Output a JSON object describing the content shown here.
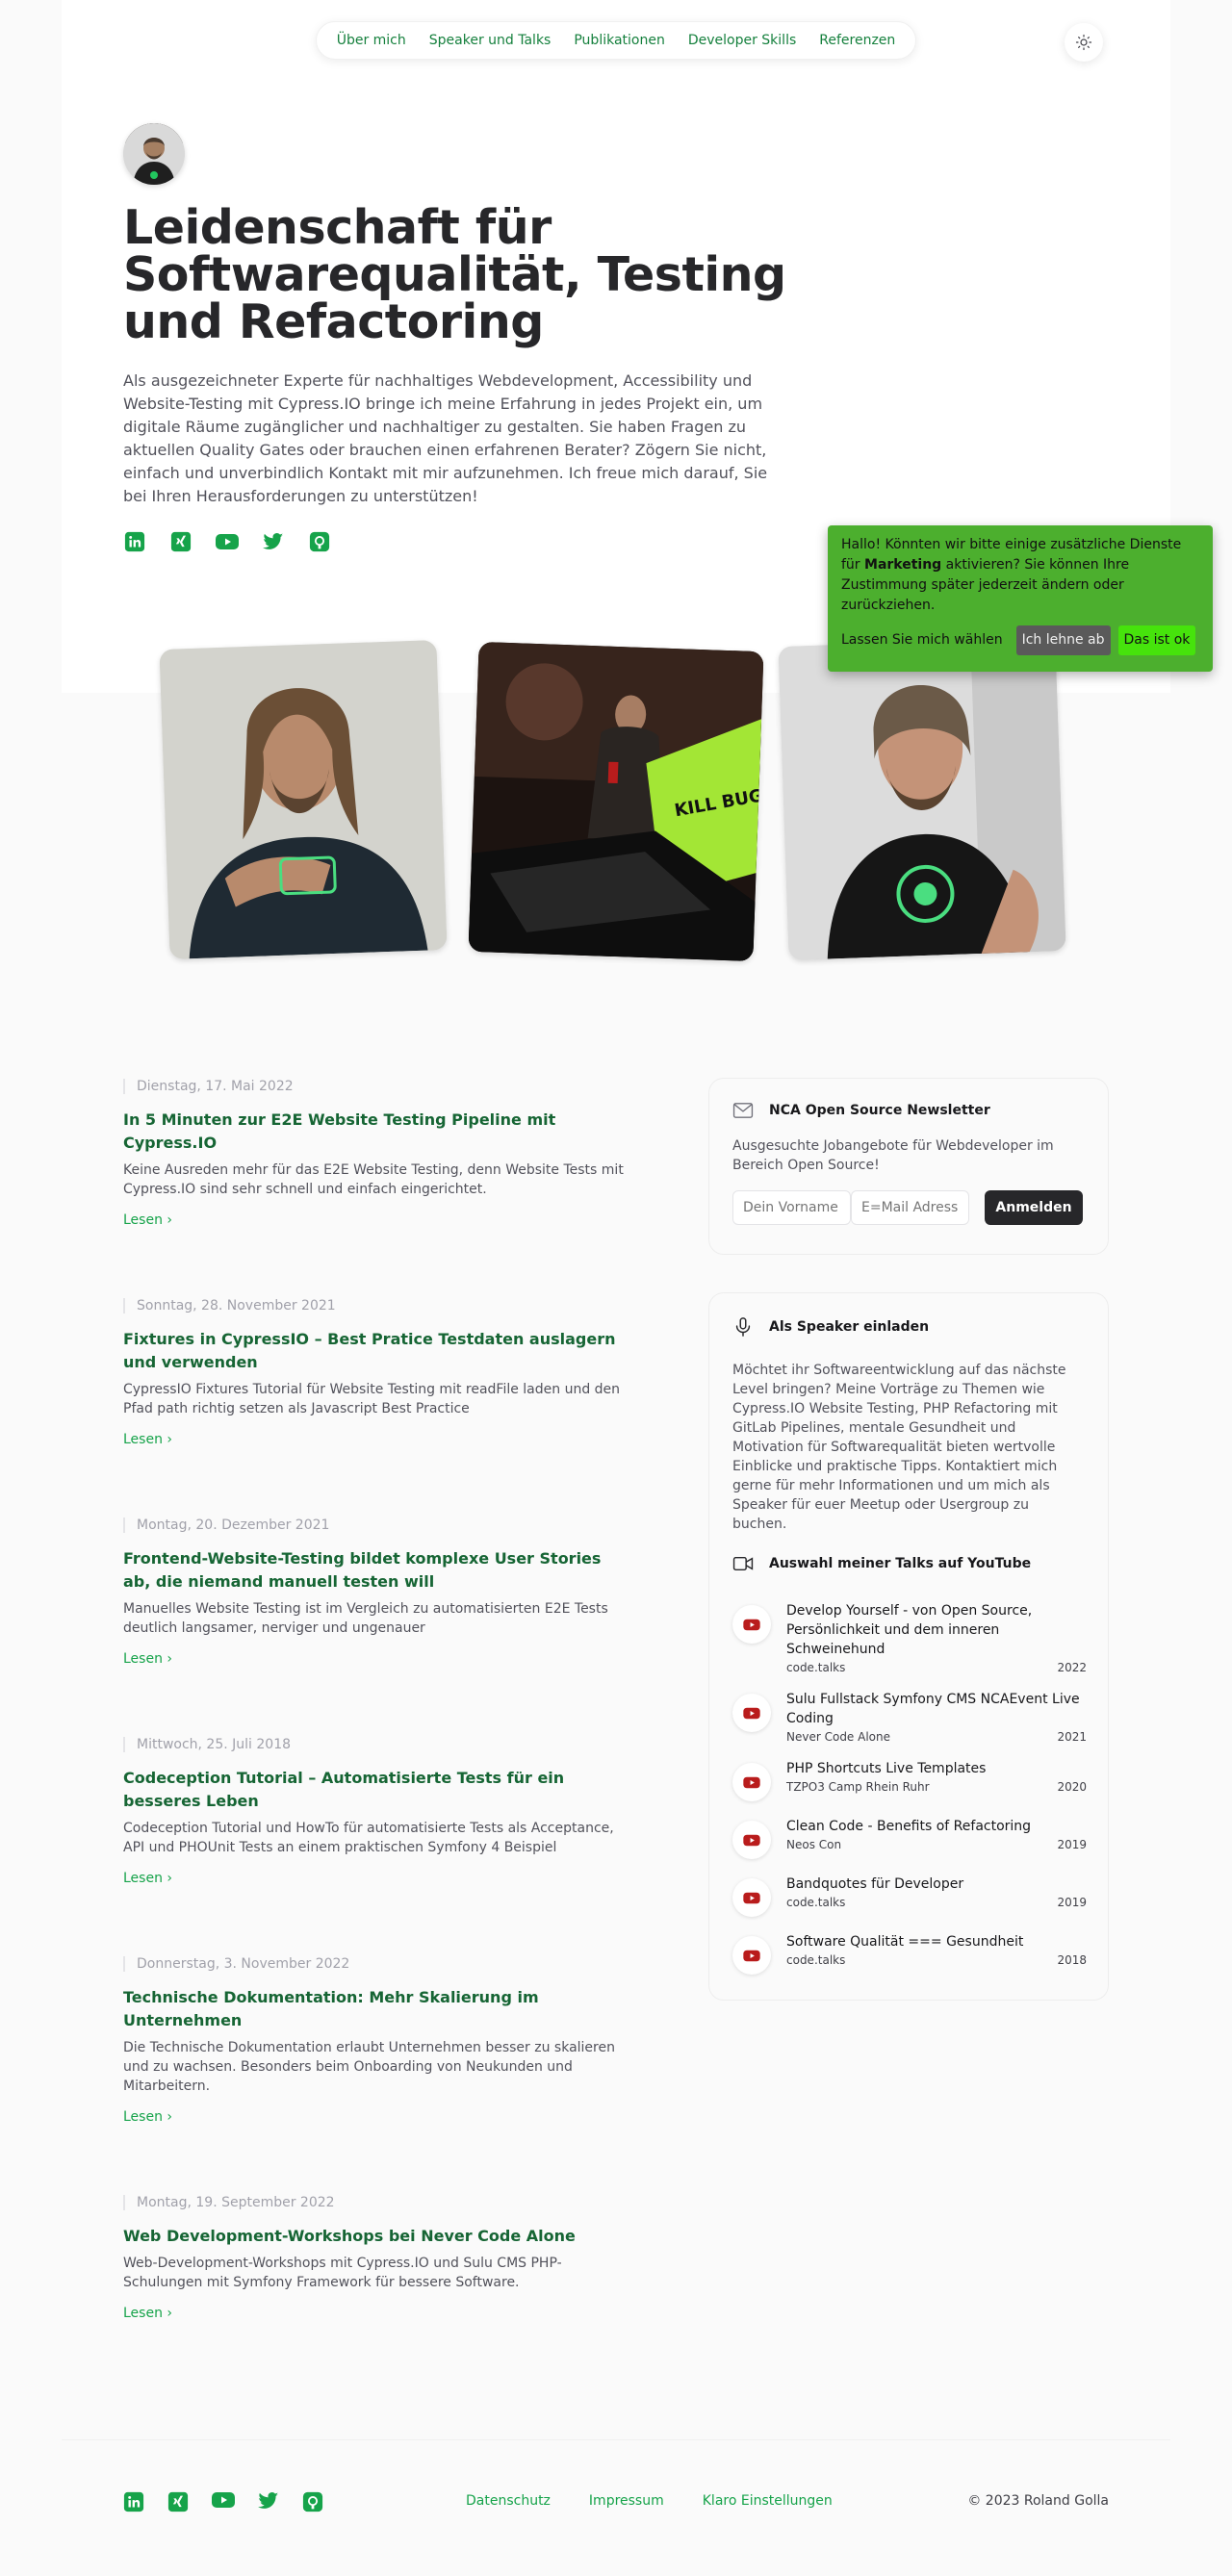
{
  "nav": {
    "items": [
      "Über mich",
      "Speaker und Talks",
      "Publikationen",
      "Developer Skills",
      "Referenzen"
    ]
  },
  "hero": {
    "title": "Leidenschaft für Softwarequalität, Testing und Refactoring",
    "text": "Als ausgezeichneter Experte für nachhaltiges Webdevelopment, Accessibility und Website-Testing mit Cypress.IO bringe ich meine Erfahrung in jedes Projekt ein, um digitale Räume zugänglicher und nachhaltiger zu gestalten. Sie haben Fragen zu aktuellen Quality Gates oder brauchen einen erfahrenen Berater? Zögern Sie nicht, einfach und unverbindlich Kontakt mit mir aufzunehmen. Ich freue mich darauf, Sie bei Ihren Herausforderungen zu unterstützen!"
  },
  "social": [
    "linkedin-icon",
    "xing-icon",
    "youtube-icon",
    "twitter-icon",
    "github-icon"
  ],
  "photos": {
    "p2_sign": "KILL BUGS"
  },
  "consent": {
    "text_before": "Hallo! Könnten wir bitte einige zusätzliche Dienste für ",
    "text_bold": "Marketing",
    "text_after": " aktivieren? Sie können Ihre Zustimmung später jederzeit ändern oder zurückziehen.",
    "learn": "Lassen Sie mich wählen",
    "decline": "Ich lehne ab",
    "accept": "Das ist ok"
  },
  "articles": [
    {
      "date": "Dienstag, 17. Mai 2022",
      "title": "In 5 Minuten zur E2E Website Testing Pipeline mit Cypress.IO",
      "desc": "Keine Ausreden mehr für das E2E Website Testing, denn Website Tests mit Cypress.IO sind sehr schnell und einfach eingerichtet.",
      "read": "Lesen"
    },
    {
      "date": "Sonntag, 28. November 2021",
      "title": "Fixtures in CypressIO – Best Pratice Testdaten auslagern und verwenden",
      "desc": "CypressIO Fixtures Tutorial für Website Testing mit readFile laden und den Pfad path richtig setzen als Javascript Best Practice",
      "read": "Lesen"
    },
    {
      "date": "Montag, 20. Dezember 2021",
      "title": "Frontend-Website-Testing bildet komplexe User Stories ab, die niemand manuell testen will",
      "desc": "Manuelles Website Testing ist im Vergleich zu automatisierten E2E Tests deutlich langsamer, nerviger und ungenauer",
      "read": "Lesen"
    },
    {
      "date": "Mittwoch, 25. Juli 2018",
      "title": "Codeception Tutorial – Automatisierte Tests für ein besseres Leben",
      "desc": "Codeception Tutorial und HowTo für automatisierte Tests als Acceptance, API und PHOUnit Tests an einem praktischen Symfony 4 Beispiel",
      "read": "Lesen"
    },
    {
      "date": "Donnerstag, 3. November 2022",
      "title": "Technische Dokumentation: Mehr Skalierung im Unternehmen",
      "desc": "Die Technische Dokumentation erlaubt Unternehmen besser zu skalieren und zu wachsen. Besonders beim Onboarding von Neukunden und Mitarbeitern.",
      "read": "Lesen"
    },
    {
      "date": "Montag, 19. September 2022",
      "title": "Web Development-Workshops bei Never Code Alone",
      "desc": "Web-Development-Workshops mit Cypress.IO und Sulu CMS PHP-Schulungen mit Symfony Framework für bessere Software.",
      "read": "Lesen"
    }
  ],
  "newsletter": {
    "title": "NCA Open Source Newsletter",
    "text": "Ausgesuchte Jobangebote für Webdeveloper im Bereich Open Source!",
    "first_name_placeholder": "Dein Vorname",
    "email_placeholder": "E=Mail Adresse",
    "submit": "Anmelden"
  },
  "speaker": {
    "title": "Als Speaker einladen",
    "text": "Möchtet ihr Softwareentwicklung auf das nächste Level bringen? Meine Vorträge zu Themen wie Cypress.IO Website Testing, PHP Refactoring mit GitLab Pipelines, mentale Gesundheit und Motivation für Softwarequalität bieten wertvolle Einblicke und praktische Tipps. Kontaktiert mich gerne für mehr Informationen und um mich als Speaker für euer Meetup oder Usergroup zu buchen.",
    "talks_title": "Auswahl meiner Talks auf YouTube",
    "talks": [
      {
        "title": "Develop Yourself - von Open Source, Persönlichkeit und dem inneren Schweinehund",
        "event": "code.talks",
        "year": "2022"
      },
      {
        "title": "Sulu Fullstack Symfony CMS NCAEvent Live Coding",
        "event": "Never Code Alone",
        "year": "2021"
      },
      {
        "title": "PHP Shortcuts Live Templates",
        "event": "TZPO3 Camp Rhein Ruhr",
        "year": "2020"
      },
      {
        "title": "Clean Code - Benefits of Refactoring",
        "event": "Neos Con",
        "year": "2019"
      },
      {
        "title": "Bandquotes für Developer",
        "event": "code.talks",
        "year": "2019"
      },
      {
        "title": "Software Qualität === Gesundheit",
        "event": "code.talks",
        "year": "2018"
      }
    ]
  },
  "footer": {
    "links": [
      "Datenschutz",
      "Impressum",
      "Klaro Einstellungen"
    ],
    "copyright": "© 2023 Roland Golla"
  },
  "colors": {
    "accent": "#16a34a",
    "consent_bg": "#4caf2e",
    "youtube": "#b91c1c"
  }
}
